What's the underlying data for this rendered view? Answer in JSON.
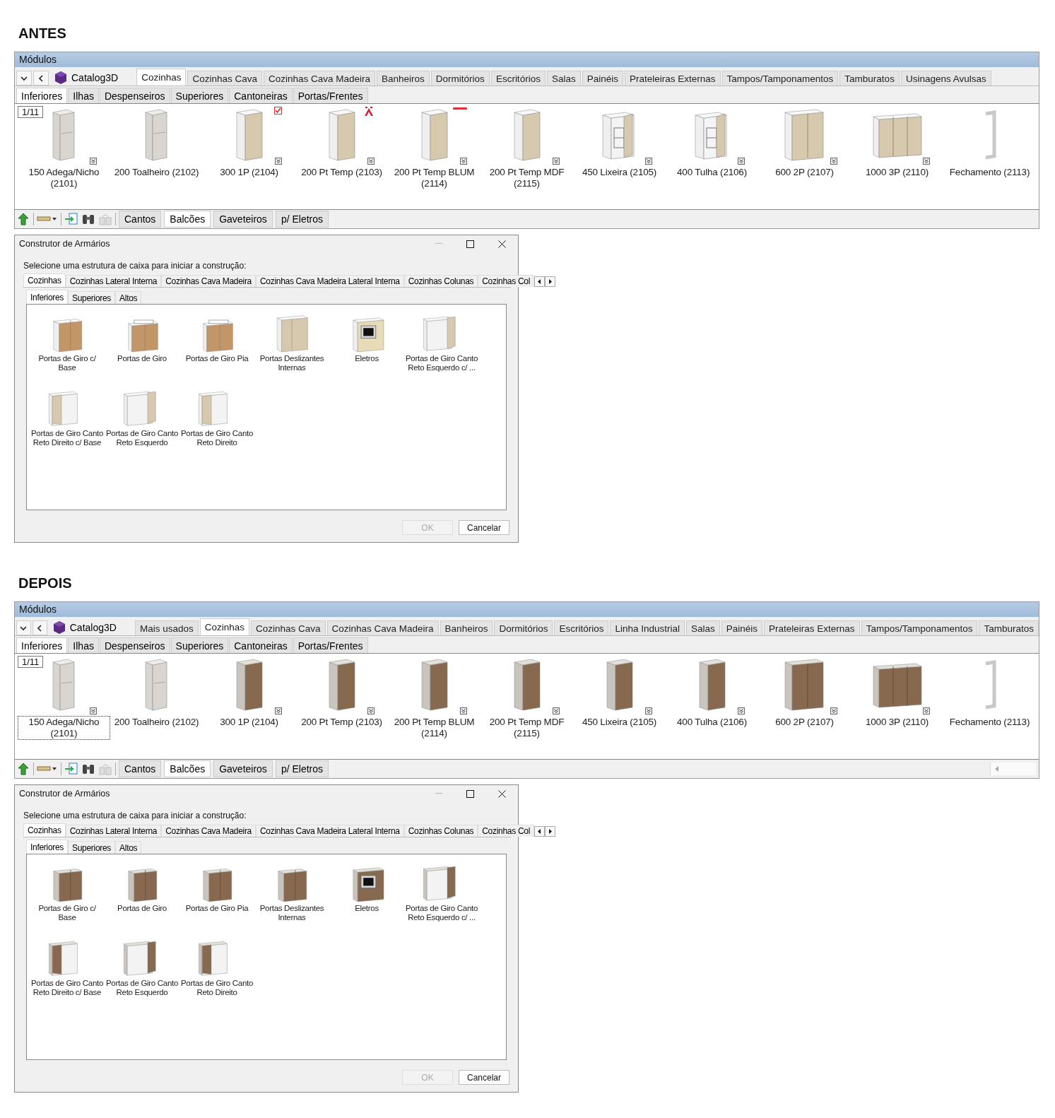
{
  "sections": [
    {
      "heading": "ANTES",
      "panel": {
        "title": "Módulos",
        "catalog": "Catalog3D",
        "page": "1/11",
        "tabs": [
          {
            "label": "Cozinhas",
            "selected": true
          },
          {
            "label": "Cozinhas Cava",
            "selected": false
          },
          {
            "label": "Cozinhas Cava Madeira",
            "selected": false
          },
          {
            "label": "Banheiros",
            "selected": false
          },
          {
            "label": "Dormitórios",
            "selected": false
          },
          {
            "label": "Escritórios",
            "selected": false
          },
          {
            "label": "Salas",
            "selected": false
          },
          {
            "label": "Painéis",
            "selected": false
          },
          {
            "label": "Prateleiras Externas",
            "selected": false
          },
          {
            "label": "Tampos/Tamponamentos",
            "selected": false
          },
          {
            "label": "Tamburatos",
            "selected": false
          },
          {
            "label": "Usinagens Avulsas",
            "selected": false
          }
        ],
        "subtabs": [
          {
            "label": "Inferiores",
            "selected": true
          },
          {
            "label": "Ilhas",
            "selected": false
          },
          {
            "label": "Despenseiros",
            "selected": false
          },
          {
            "label": "Superiores",
            "selected": false
          },
          {
            "label": "Cantoneiras",
            "selected": false
          },
          {
            "label": "Portas/Frentes",
            "selected": false
          }
        ],
        "items": [
          {
            "label": "150 Adega/Nicho (2101)",
            "kind": "open",
            "variants": true,
            "focused": false
          },
          {
            "label": "200 Toalheiro (2102)",
            "kind": "open",
            "variants": false,
            "focused": false
          },
          {
            "label": "300 1P (2104)",
            "kind": "door",
            "color": "#d6c9ae",
            "variants": true,
            "focused": false,
            "badge": {
              "kind": "check"
            }
          },
          {
            "label": "200 Pt Temp (2103)",
            "kind": "door",
            "color": "#d6c9ae",
            "variants": true,
            "focused": false,
            "badge": {
              "kind": "brand"
            }
          },
          {
            "label": "200 Pt Temp BLUM (2114)",
            "kind": "door",
            "color": "#d6c9ae",
            "variants": true,
            "focused": false,
            "badge": {
              "kind": "wordmark"
            }
          },
          {
            "label": "200 Pt Temp MDF (2115)",
            "kind": "door",
            "color": "#d6c9ae",
            "variants": true,
            "focused": false
          },
          {
            "label": "450 Lixeira (2105)",
            "kind": "basket",
            "color": "#d6c9ae",
            "variants": true,
            "focused": false
          },
          {
            "label": "400 Tulha (2106)",
            "kind": "basket",
            "color": "#d6c9ae",
            "variants": true,
            "focused": false
          },
          {
            "label": "600 2P (2107)",
            "kind": "double",
            "color": "#d6c9ae",
            "variants": true,
            "focused": false
          },
          {
            "label": "1000 3P (2110)",
            "kind": "triple",
            "color": "#d6c9ae",
            "variants": true,
            "focused": false
          },
          {
            "label": "Fechamento (2113)",
            "kind": "frame",
            "variants": false,
            "focused": false
          }
        ],
        "bottom_tabs": [
          {
            "label": "Cantos",
            "selected": false
          },
          {
            "label": "Balcões",
            "selected": true
          },
          {
            "label": "Gaveteiros",
            "selected": false
          },
          {
            "label": "p/ Eletros",
            "selected": false
          }
        ]
      },
      "dialog": {
        "title": "Construtor de Armários",
        "prompt": "Selecione uma estrutura de caixa para iniciar a construção:",
        "tabs": [
          {
            "label": "Cozinhas",
            "selected": true
          },
          {
            "label": "Cozinhas Lateral Interna",
            "selected": false
          },
          {
            "label": "Cozinhas Cava Madeira",
            "selected": false
          },
          {
            "label": "Cozinhas Cava Madeira Lateral Interna",
            "selected": false
          },
          {
            "label": "Cozinhas Colunas",
            "selected": false
          },
          {
            "label": "Cozinhas Col",
            "selected": false
          }
        ],
        "subtabs": [
          {
            "label": "Inferiores",
            "selected": true
          },
          {
            "label": "Superiores",
            "selected": false
          },
          {
            "label": "Altos",
            "selected": false
          }
        ],
        "items": [
          {
            "label": "Portas de Giro c/ Base",
            "kind": "base",
            "color": "#c39668"
          },
          {
            "label": "Portas de Giro",
            "kind": "sink",
            "color": "#c39668"
          },
          {
            "label": "Portas de Giro Pia",
            "kind": "sink",
            "color": "#c39668"
          },
          {
            "label": "Portas Deslizantes Internas",
            "kind": "sliding",
            "color": "#d6c9ae"
          },
          {
            "label": "Eletros",
            "kind": "oven",
            "color": "#e8dcb8"
          },
          {
            "label": "Portas de Giro Canto Reto Esquerdo c/ ...",
            "kind": "corner-left",
            "color": "#d6c9ae"
          },
          {
            "label": "Portas de Giro Canto Reto Direito c/ Base",
            "kind": "corner-right",
            "color": "#d6c9ae"
          },
          {
            "label": "Portas de Giro Canto Reto Esquerdo",
            "kind": "corner-left",
            "color": "#d6c9ae"
          },
          {
            "label": "Portas de Giro Canto Reto Direito",
            "kind": "corner-right",
            "color": "#d6c9ae"
          }
        ],
        "buttons": [
          {
            "label": "OK",
            "disabled": true
          },
          {
            "label": "Cancelar",
            "disabled": false
          }
        ]
      }
    },
    {
      "heading": "DEPOIS",
      "panel": {
        "title": "Módulos",
        "catalog": "Catalog3D",
        "page": "1/11",
        "scroll_arrow": true,
        "tabs": [
          {
            "label": "Mais usados",
            "selected": false
          },
          {
            "label": "Cozinhas",
            "selected": true
          },
          {
            "label": "Cozinhas Cava",
            "selected": false
          },
          {
            "label": "Cozinhas Cava Madeira",
            "selected": false
          },
          {
            "label": "Banheiros",
            "selected": false
          },
          {
            "label": "Dormitórios",
            "selected": false
          },
          {
            "label": "Escritórios",
            "selected": false
          },
          {
            "label": "Linha Industrial",
            "selected": false
          },
          {
            "label": "Salas",
            "selected": false
          },
          {
            "label": "Painéis",
            "selected": false
          },
          {
            "label": "Prateleiras Externas",
            "selected": false
          },
          {
            "label": "Tampos/Tamponamentos",
            "selected": false
          },
          {
            "label": "Tamburatos",
            "selected": false
          }
        ],
        "subtabs": [
          {
            "label": "Inferiores",
            "selected": true
          },
          {
            "label": "Ilhas",
            "selected": false
          },
          {
            "label": "Despenseiros",
            "selected": false
          },
          {
            "label": "Superiores",
            "selected": false
          },
          {
            "label": "Cantoneiras",
            "selected": false
          },
          {
            "label": "Portas/Frentes",
            "selected": false
          }
        ],
        "items": [
          {
            "label": "150 Adega/Nicho (2101)",
            "kind": "open",
            "variants": true,
            "focused": true
          },
          {
            "label": "200 Toalheiro (2102)",
            "kind": "open",
            "variants": false,
            "focused": false
          },
          {
            "label": "300 1P (2104)",
            "kind": "door",
            "color": "#86694f",
            "variants": true,
            "focused": false
          },
          {
            "label": "200 Pt Temp (2103)",
            "kind": "door",
            "color": "#86694f",
            "variants": true,
            "focused": false
          },
          {
            "label": "200 Pt Temp BLUM (2114)",
            "kind": "door",
            "color": "#86694f",
            "variants": true,
            "focused": false
          },
          {
            "label": "200 Pt Temp MDF (2115)",
            "kind": "door",
            "color": "#86694f",
            "variants": true,
            "focused": false
          },
          {
            "label": "450 Lixeira (2105)",
            "kind": "door",
            "color": "#86694f",
            "variants": true,
            "focused": false
          },
          {
            "label": "400 Tulha (2106)",
            "kind": "door",
            "color": "#86694f",
            "variants": true,
            "focused": false
          },
          {
            "label": "600 2P (2107)",
            "kind": "double",
            "color": "#86694f",
            "variants": true,
            "focused": false
          },
          {
            "label": "1000 3P (2110)",
            "kind": "triple",
            "color": "#86694f",
            "variants": true,
            "focused": false
          },
          {
            "label": "Fechamento (2113)",
            "kind": "frame",
            "variants": false,
            "focused": false
          }
        ],
        "bottom_tabs": [
          {
            "label": "Cantos",
            "selected": false
          },
          {
            "label": "Balcões",
            "selected": true
          },
          {
            "label": "Gaveteiros",
            "selected": false
          },
          {
            "label": "p/ Eletros",
            "selected": false
          }
        ]
      },
      "dialog": {
        "title": "Construtor de Armários",
        "prompt": "Selecione uma estrutura de caixa para iniciar a construção:",
        "tabs": [
          {
            "label": "Cozinhas",
            "selected": true
          },
          {
            "label": "Cozinhas Lateral Interna",
            "selected": false
          },
          {
            "label": "Cozinhas Cava Madeira",
            "selected": false
          },
          {
            "label": "Cozinhas Cava Madeira Lateral Interna",
            "selected": false
          },
          {
            "label": "Cozinhas Colunas",
            "selected": false
          },
          {
            "label": "Cozinhas Col",
            "selected": false
          }
        ],
        "subtabs": [
          {
            "label": "Inferiores",
            "selected": true
          },
          {
            "label": "Superiores",
            "selected": false
          },
          {
            "label": "Altos",
            "selected": false
          }
        ],
        "items": [
          {
            "label": "Portas de Giro c/ Base",
            "kind": "base",
            "color": "#86694f"
          },
          {
            "label": "Portas de Giro",
            "kind": "base",
            "color": "#86694f"
          },
          {
            "label": "Portas de Giro Pia",
            "kind": "base",
            "color": "#86694f"
          },
          {
            "label": "Portas Deslizantes Internas",
            "kind": "base",
            "color": "#86694f"
          },
          {
            "label": "Eletros",
            "kind": "oven",
            "color": "#86694f"
          },
          {
            "label": "Portas de Giro Canto Reto Esquerdo c/ ...",
            "kind": "corner-left",
            "color": "#86694f"
          },
          {
            "label": "Portas de Giro Canto Reto Direito c/ Base",
            "kind": "corner-right",
            "color": "#86694f"
          },
          {
            "label": "Portas de Giro Canto Reto Esquerdo",
            "kind": "corner-left",
            "color": "#86694f"
          },
          {
            "label": "Portas de Giro Canto Reto Direito",
            "kind": "corner-right",
            "color": "#86694f"
          }
        ],
        "buttons": [
          {
            "label": "OK",
            "disabled": true
          },
          {
            "label": "Cancelar",
            "disabled": false
          }
        ]
      }
    }
  ]
}
